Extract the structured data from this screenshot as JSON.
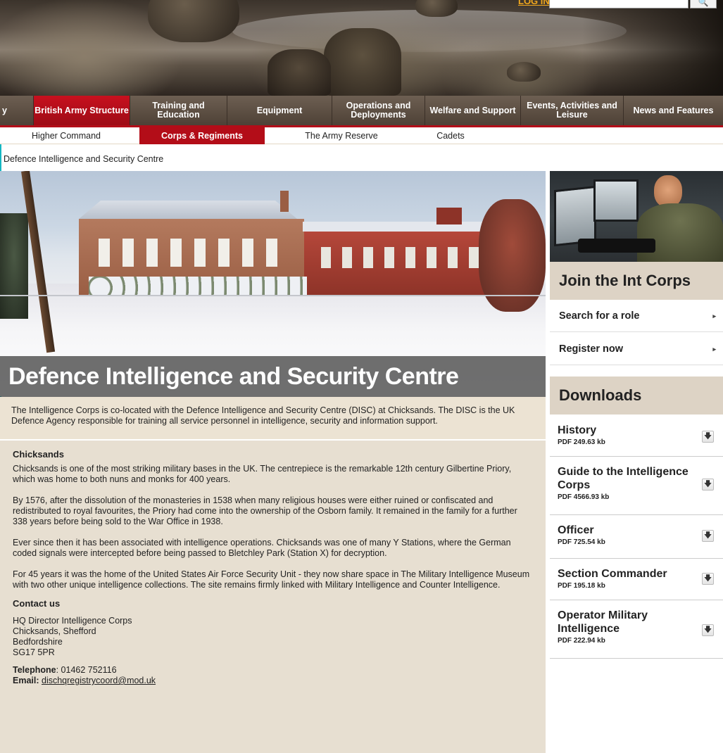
{
  "header": {
    "login_label": "LOG IN",
    "search_placeholder": "",
    "search_icon": "magnifier-icon"
  },
  "main_nav": {
    "items": [
      {
        "label": "y",
        "active": false
      },
      {
        "label": "British Army Structure",
        "active": true
      },
      {
        "label": "Training and Education",
        "active": false
      },
      {
        "label": "Equipment",
        "active": false
      },
      {
        "label": "Operations and Deployments",
        "active": false
      },
      {
        "label": "Welfare and Support",
        "active": false
      },
      {
        "label": "Events, Activities and Leisure",
        "active": false
      },
      {
        "label": "News and Features",
        "active": false
      }
    ]
  },
  "sub_nav": {
    "items": [
      {
        "label": "Higher Command",
        "active": false
      },
      {
        "label": "Corps & Regiments",
        "active": true
      },
      {
        "label": "The Army Reserve",
        "active": false
      },
      {
        "label": "Cadets",
        "active": false
      }
    ]
  },
  "breadcrumb": "Defence Intelligence and Security Centre",
  "hero": {
    "title": "Defence Intelligence and Security Centre"
  },
  "intro": "The Intelligence Corps is co-located with the Defence Intelligence and Security Centre (DISC) at Chicksands. The DISC is the UK Defence Agency responsible for training all service personnel in intelligence, security and information support.",
  "content": {
    "chicksands_heading": "Chicksands",
    "paragraphs": [
      "Chicksands is one of the most striking military bases in the UK. The centrepiece is the remarkable 12th century Gilbertine Priory, which was home to both nuns and monks for 400 years.",
      "By 1576, after the dissolution of the monasteries in 1538 when many religious houses were either ruined or confiscated and redistributed to royal favourites, the Priory had come into the ownership of the Osborn family. It remained in the family for a further 338 years before being sold to the War Office in 1938.",
      "Ever since then it has been associated with intelligence operations. Chicksands was one of many Y Stations, where the German coded signals were intercepted before being passed to Bletchley Park (Station X) for decryption.",
      "For 45 years it was the home of the United States Air Force Security Unit - they now share space in The Military Intelligence Museum with two other unique intelligence collections. The site remains firmly linked with Military Intelligence and Counter Intelligence."
    ],
    "contact_heading": "Contact us",
    "address": [
      "HQ Director Intelligence Corps",
      "Chicksands, Shefford",
      "Bedfordshire",
      "SG17 5PR"
    ],
    "telephone_label": "Telephone",
    "telephone": ": 01462 752116",
    "email_label": "Email:",
    "email": "dischqregistrycoord@mod.uk"
  },
  "sidebar": {
    "join_heading": "Join the Int Corps",
    "join_links": [
      "Search for a role",
      "Register now"
    ],
    "downloads_heading": "Downloads",
    "downloads": [
      {
        "title": "History",
        "meta": "PDF 249.63 kb"
      },
      {
        "title": "Guide to the Intelligence Corps",
        "meta": "PDF 4566.93 kb"
      },
      {
        "title": "Officer",
        "meta": "PDF 725.54 kb"
      },
      {
        "title": "Section Commander",
        "meta": "PDF 195.18 kb"
      },
      {
        "title": "Operator Military Intelligence",
        "meta": "PDF 222.94 kb"
      }
    ]
  },
  "colors": {
    "accent_red": "#b30d18",
    "nav_brown": "#5a4c40",
    "login_orange": "#f2a81d",
    "panel_beige": "#e7dfd1"
  }
}
